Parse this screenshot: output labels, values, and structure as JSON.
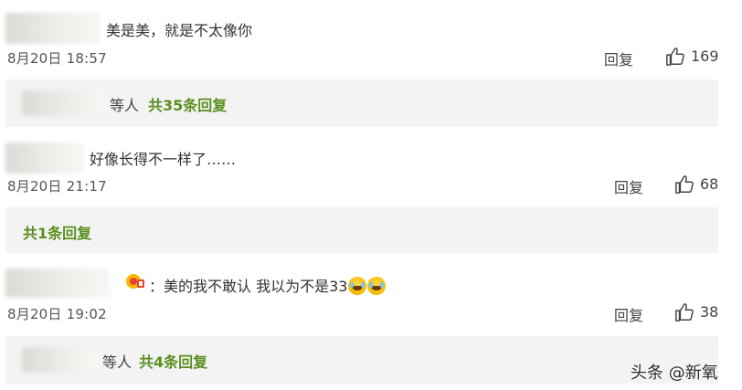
{
  "comments": [
    {
      "text": "美是美，就是不太像你",
      "time": "8月20日 18:57",
      "reply_label": "回复",
      "likes": "169",
      "thread": {
        "prefix": "等人",
        "link": "共35条回复"
      }
    },
    {
      "text": "好像长得不一样了……",
      "time": "8月20日 21:17",
      "reply_label": "回复",
      "likes": "68",
      "thread": {
        "link": "共1条回复"
      }
    },
    {
      "text": "：美的我不敢认 我以为不是33",
      "time": "8月20日 19:02",
      "reply_label": "回复",
      "likes": "38",
      "thread": {
        "prefix": "等人",
        "link": "共4条回复"
      }
    }
  ],
  "watermark": "头条 @新氧",
  "colors": {
    "link_green": "#5a8f20",
    "sub_bg": "#f3f3f3",
    "text": "#333333"
  },
  "icons": [
    "thumbs-up-icon",
    "crying-laughing-emoji",
    "user-badge-icon"
  ]
}
